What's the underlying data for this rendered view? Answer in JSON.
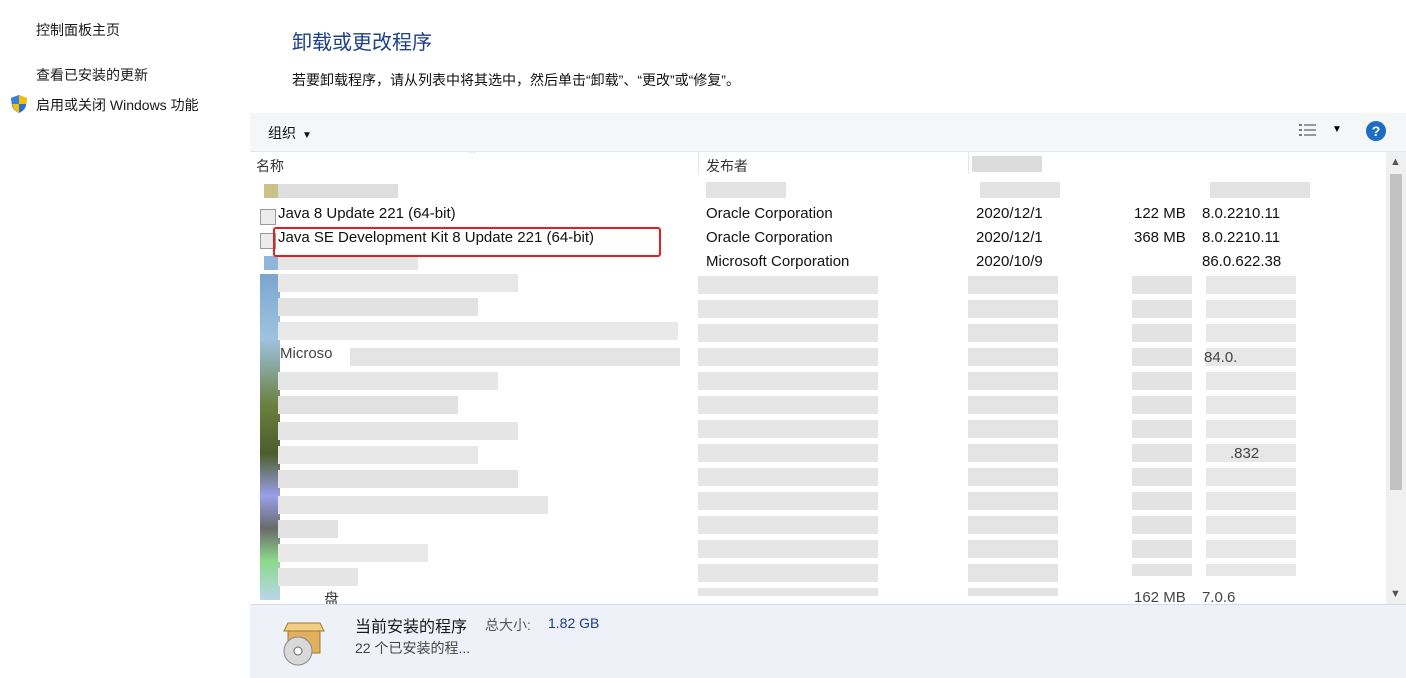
{
  "sidebar": {
    "home": "控制面板主页",
    "updates": "查看已安装的更新",
    "features": "启用或关闭 Windows 功能"
  },
  "main": {
    "title": "卸载或更改程序",
    "description": "若要卸载程序，请从列表中将其选中，然后单击“卸载”、“更改”或“修复”。"
  },
  "toolbar": {
    "organize": "组织",
    "help": "?"
  },
  "columns": {
    "name": "名称",
    "publisher": "发布者"
  },
  "rows": [
    {
      "name": "Java 8 Update 221 (64-bit)",
      "publisher": "Oracle Corporation",
      "date": "2020/12/1",
      "size": "122 MB",
      "version": "8.0.2210.11"
    },
    {
      "name": "Java SE Development Kit 8 Update 221 (64-bit)",
      "publisher": "Oracle Corporation",
      "date": "2020/12/1",
      "size": "368 MB",
      "version": "8.0.2210.11"
    },
    {
      "name": "",
      "publisher": "Microsoft Corporation",
      "date": "2020/10/9",
      "size": "",
      "version": "86.0.622.38"
    }
  ],
  "partial_visible": {
    "ms_row": "Microso",
    "version_a": "84.0.",
    "version_b": ".832",
    "version_c": "7.0.6",
    "size_last": "162 MB",
    "char_a": "盘"
  },
  "status": {
    "title": "当前安装的程序",
    "size_label": "总大小:",
    "size_value": "1.82 GB",
    "count": "22 个已安装的程..."
  },
  "colors": {
    "highlight": "#e02020",
    "title": "#1e3f8a",
    "status_bg": "#eef2f8"
  }
}
